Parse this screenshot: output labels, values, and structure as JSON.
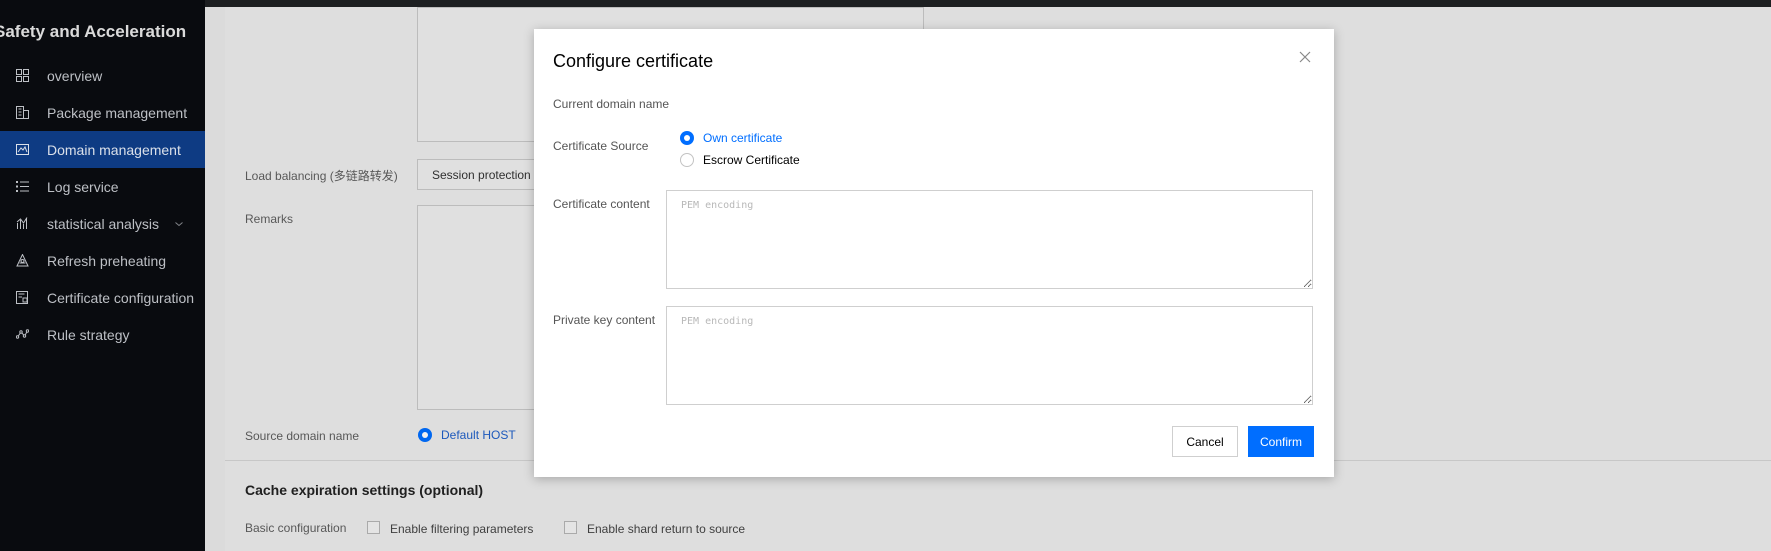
{
  "sidebar": {
    "title": "Safety and Acceleration",
    "items": [
      {
        "label": "overview",
        "icon": "grid-icon"
      },
      {
        "label": "Package management",
        "icon": "package-icon"
      },
      {
        "label": "Domain management",
        "icon": "domain-icon",
        "active": true
      },
      {
        "label": "Log service",
        "icon": "list-icon"
      },
      {
        "label": "statistical analysis",
        "icon": "bar-chart-icon"
      },
      {
        "label": "Refresh preheating",
        "icon": "refresh-icon"
      },
      {
        "label": "Certificate configuration",
        "icon": "certificate-icon"
      },
      {
        "label": "Rule strategy",
        "icon": "rule-icon"
      }
    ]
  },
  "background": {
    "load_balancing_label": "Load balancing (多链路转发)",
    "load_balancing_value": "Session protection",
    "remarks_label": "Remarks",
    "source_domain_label": "Source domain name",
    "source_domain_option": "Default HOST",
    "cache_title": "Cache expiration settings (optional)",
    "basic_config_label": "Basic configuration",
    "filter_params_label": "Enable filtering parameters",
    "shard_return_label": "Enable shard return to source"
  },
  "modal": {
    "title": "Configure certificate",
    "current_domain_label": "Current domain name",
    "cert_source_label": "Certificate Source",
    "own_cert_label": "Own certificate",
    "escrow_cert_label": "Escrow Certificate",
    "cert_content_label": "Certificate content",
    "cert_placeholder": "PEM encoding",
    "private_key_label": "Private key content",
    "private_key_placeholder": "PEM encoding",
    "cancel_label": "Cancel",
    "confirm_label": "Confirm"
  },
  "colors": {
    "accent": "#006eff",
    "sidebar_bg": "#0a0c10",
    "sidebar_active": "#0f3f8c"
  }
}
